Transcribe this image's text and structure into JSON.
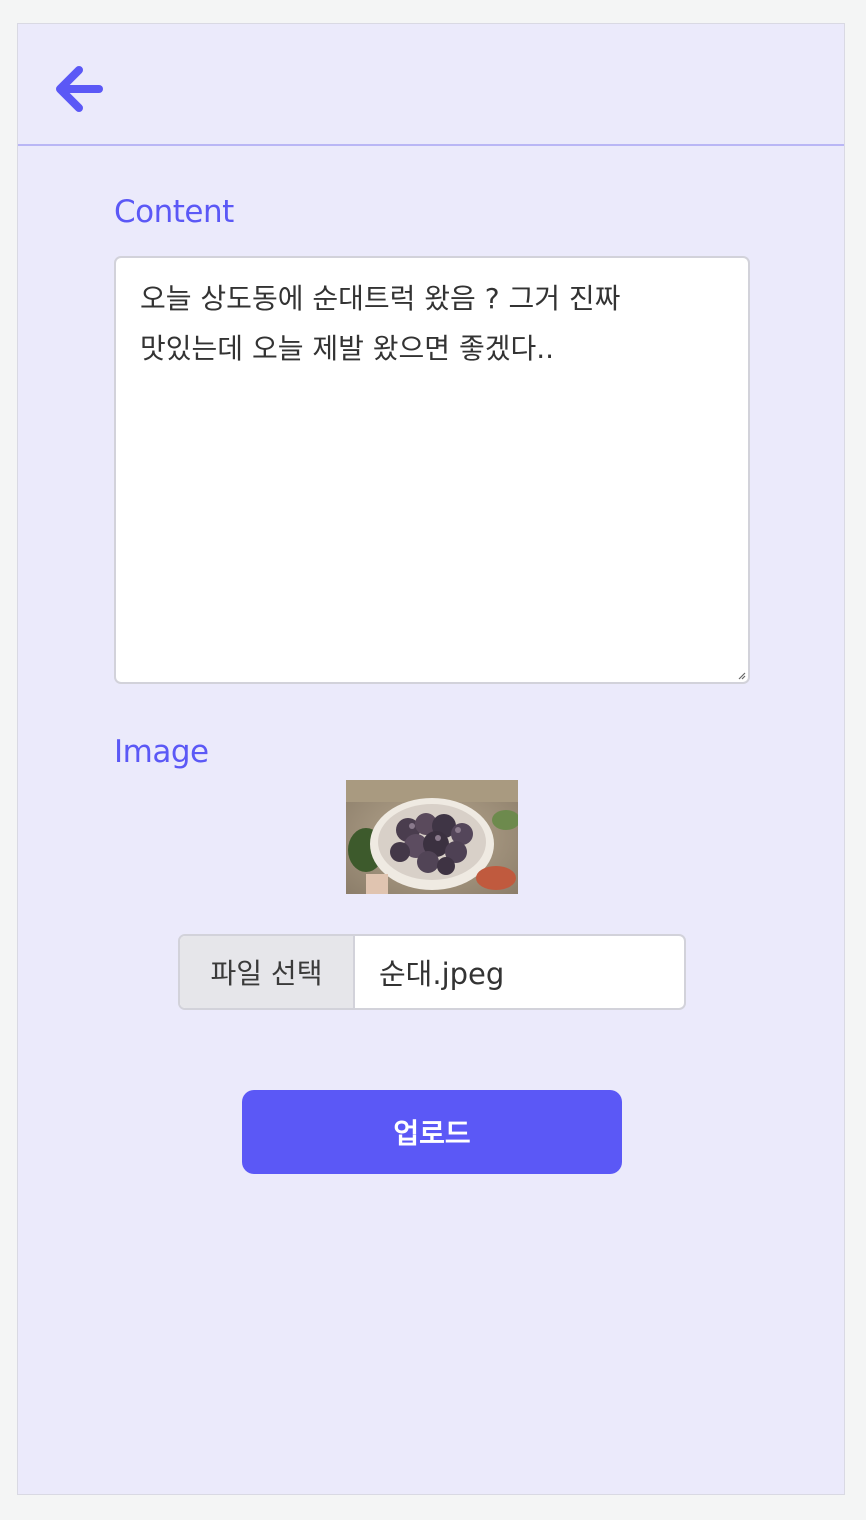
{
  "header": {
    "back_icon": "arrow-left-icon"
  },
  "form": {
    "content_label": "Content",
    "content_value": "오늘 상도동에 순대트럭 왔음 ? 그거 진짜 맛있는데 오늘 제발 왔으면 좋겠다..",
    "image_label": "Image",
    "file_button_label": "파일 선택",
    "file_name": "순대.jpeg",
    "upload_label": "업로드"
  },
  "colors": {
    "accent": "#5b58f6",
    "background": "#ebeafb",
    "divider": "#b9b6f5"
  }
}
